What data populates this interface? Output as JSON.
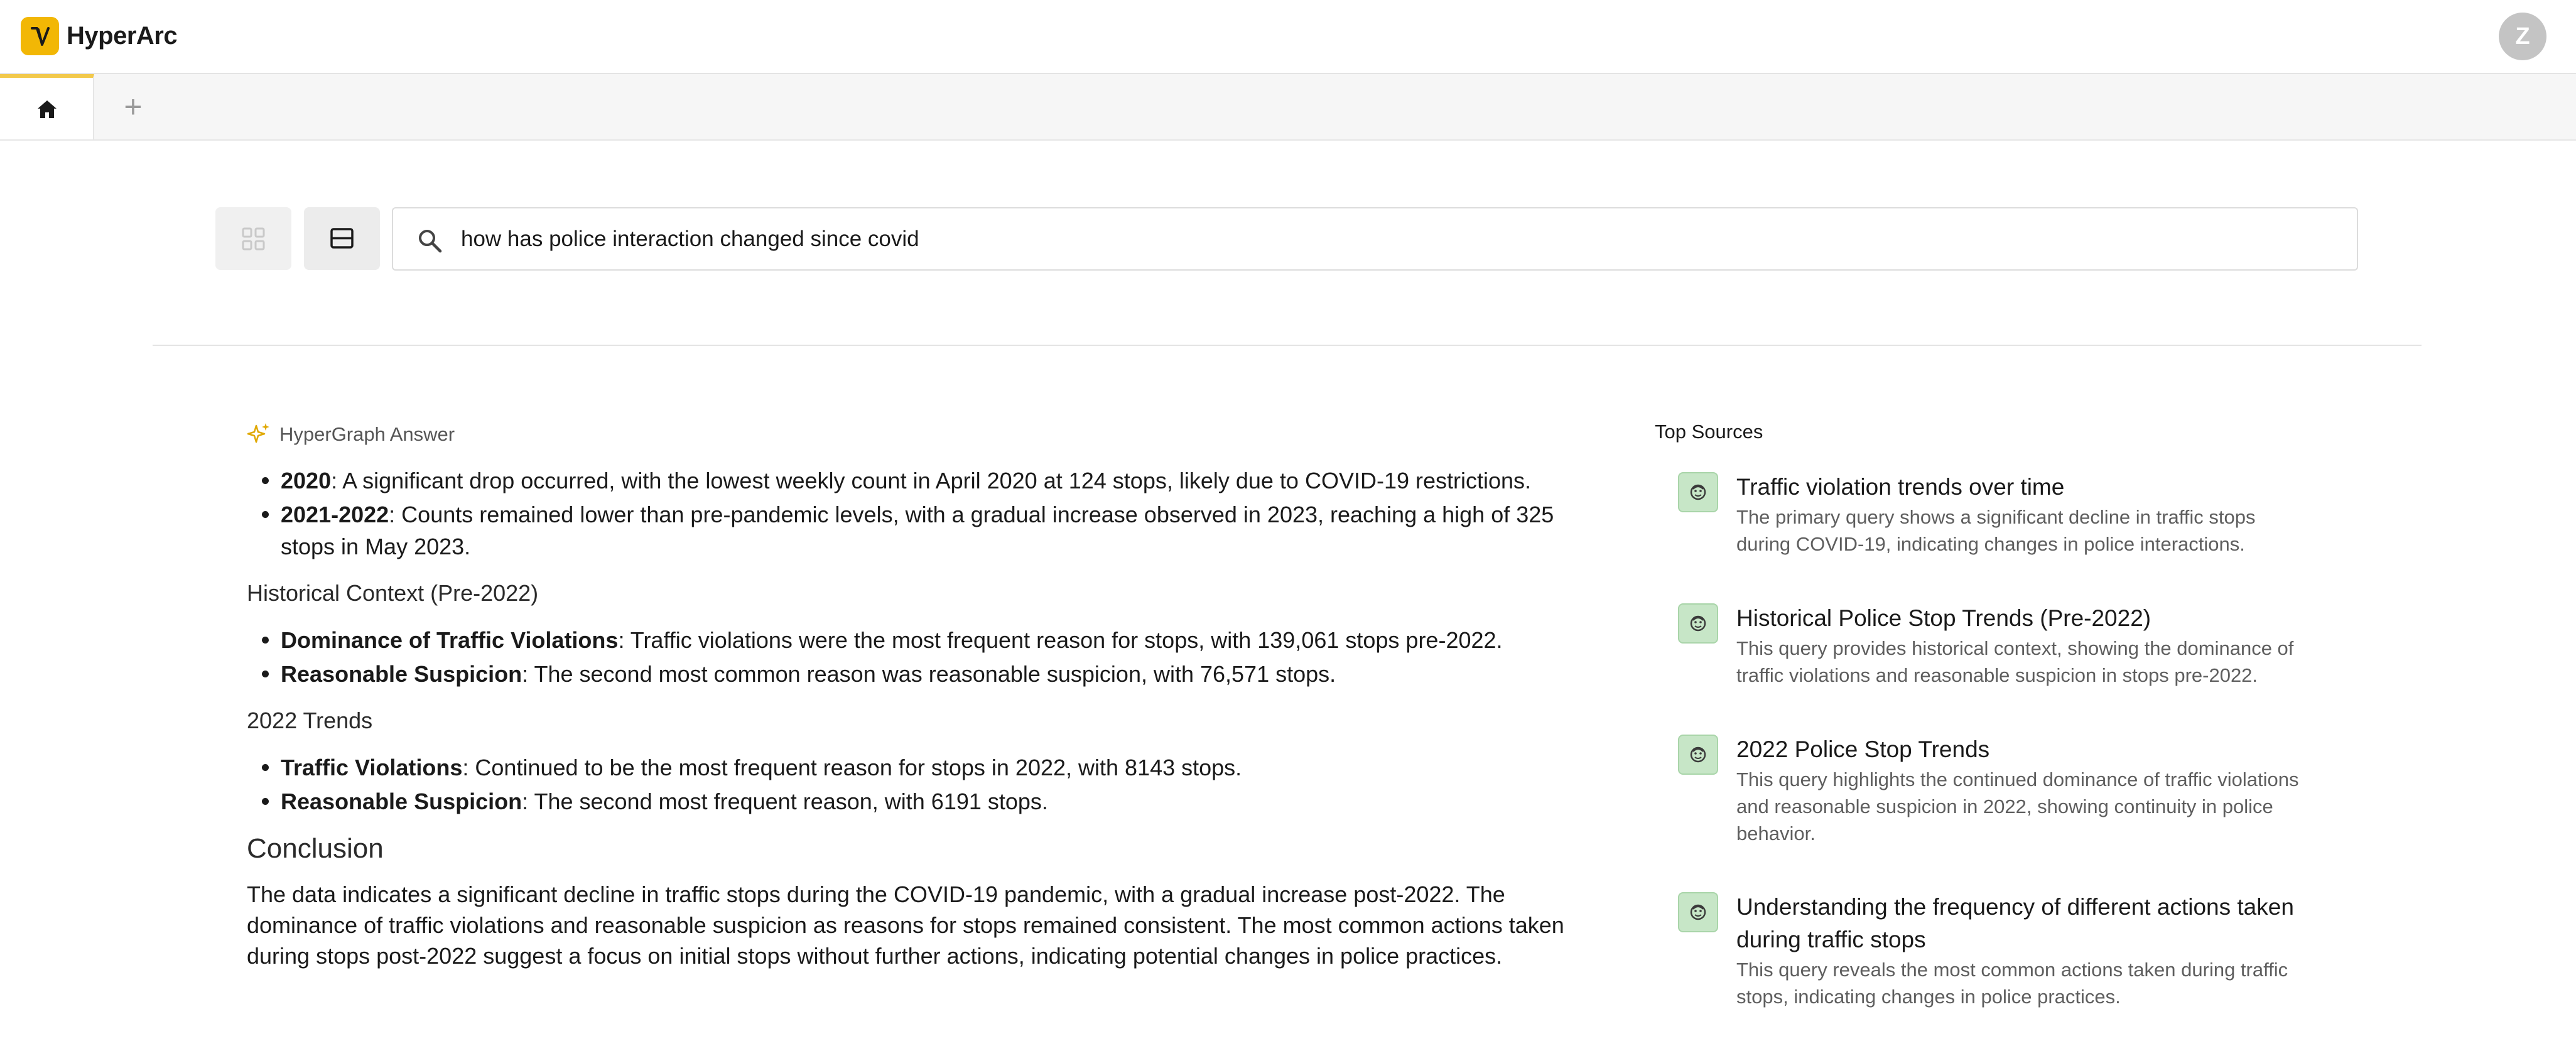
{
  "app": {
    "name": "HyperArc",
    "user_initial": "Z"
  },
  "tabs": {
    "add_label": "+"
  },
  "search": {
    "query": "how has police interaction changed since covid"
  },
  "answer": {
    "label": "HyperGraph Answer",
    "covid_items": [
      {
        "term": "2020",
        "text": ": A significant drop occurred, with the lowest weekly count in April 2020 at 124 stops, likely due to COVID-19 restrictions."
      },
      {
        "term": "2021-2022",
        "text": ": Counts remained lower than pre-pandemic levels, with a gradual increase observed in 2023, reaching a high of 325 stops in May 2023."
      }
    ],
    "historical_heading": "Historical Context (Pre-2022)",
    "historical_items": [
      {
        "term": "Dominance of Traffic Violations",
        "text": ": Traffic violations were the most frequent reason for stops, with 139,061 stops pre-2022."
      },
      {
        "term": "Reasonable Suspicion",
        "text": ": The second most common reason was reasonable suspicion, with 76,571 stops."
      }
    ],
    "trends_heading": "2022 Trends",
    "trends_items": [
      {
        "term": "Traffic Violations",
        "text": ": Continued to be the most frequent reason for stops in 2022, with 8143 stops."
      },
      {
        "term": "Reasonable Suspicion",
        "text": ": The second most frequent reason, with 6191 stops."
      }
    ],
    "conclusion_heading": "Conclusion",
    "conclusion_text": "The data indicates a significant decline in traffic stops during the COVID-19 pandemic, with a gradual increase post-2022. The dominance of traffic violations and reasonable suspicion as reasons for stops remained consistent. The most common actions taken during stops post-2022 suggest a focus on initial stops without further actions, indicating potential changes in police practices."
  },
  "sources": {
    "label": "Top Sources",
    "items": [
      {
        "title": "Traffic violation trends over time",
        "description": "The primary query shows a significant decline in traffic stops during COVID-19, indicating changes in police interactions."
      },
      {
        "title": "Historical Police Stop Trends (Pre-2022)",
        "description": "This query provides historical context, showing the dominance of traffic violations and reasonable suspicion in stops pre-2022."
      },
      {
        "title": "2022 Police Stop Trends",
        "description": "This query highlights the continued dominance of traffic violations and reasonable suspicion in 2022, showing continuity in police behavior."
      },
      {
        "title": "Understanding the frequency of different actions taken during traffic stops",
        "description": "This query reveals the most common actions taken during traffic stops, indicating changes in police practices."
      }
    ]
  },
  "colors": {
    "brand": "#f2b705",
    "source_icon_bg": "#c7e6c7",
    "tab_accent": "#f2c94c"
  },
  "icons": {
    "logo": "hyperarc-logo-icon",
    "home": "home-icon",
    "grid_view": "grid-view-icon",
    "list_view": "list-view-icon",
    "search": "search-icon",
    "sparkle": "sparkle-icon",
    "source": "source-face-icon"
  }
}
